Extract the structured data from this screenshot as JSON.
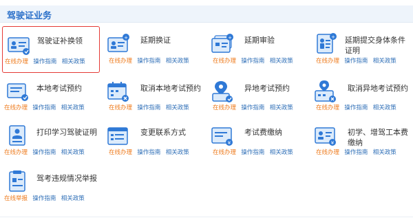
{
  "section_title": "驾驶证业务",
  "links": {
    "online": "在线办理",
    "online_report": "在线举报",
    "guide": "操作指南",
    "policy": "相关政策"
  },
  "colors": {
    "accent_blue": "#2f79d6",
    "light_blue": "#dcebfb",
    "link_orange": "#ee7b1d",
    "link_blue": "#2f6fb7",
    "selected_border": "#e53935"
  },
  "services": [
    {
      "title": "驾驶证补换领",
      "icon": "license-card-icon",
      "selected": true
    },
    {
      "title": "延期换证",
      "icon": "license-card-badge-icon",
      "selected": false
    },
    {
      "title": "延期审验",
      "icon": "license-stack-badge-icon",
      "selected": false
    },
    {
      "title": "延期提交身体条件证明",
      "icon": "health-certificate-icon",
      "selected": false
    },
    {
      "title": "本地考试预约",
      "icon": "local-exam-icon",
      "selected": false
    },
    {
      "title": "取消本地考试预约",
      "icon": "calendar-cancel-icon",
      "selected": false
    },
    {
      "title": "异地考试预约",
      "icon": "location-exam-icon",
      "selected": false
    },
    {
      "title": "取消异地考试预约",
      "icon": "location-calendar-cancel-icon",
      "selected": false
    },
    {
      "title": "打印学习驾驶证明",
      "icon": "print-certificate-icon",
      "selected": false
    },
    {
      "title": "变更联系方式",
      "icon": "contact-change-icon",
      "selected": false
    },
    {
      "title": "考试费缴纳",
      "icon": "exam-fee-icon",
      "selected": false
    },
    {
      "title": "初学、增驾工本费缴纳",
      "icon": "license-fee-icon",
      "selected": false
    },
    {
      "title": "驾考违规情况举报",
      "icon": "violation-report-icon",
      "selected": false
    }
  ]
}
